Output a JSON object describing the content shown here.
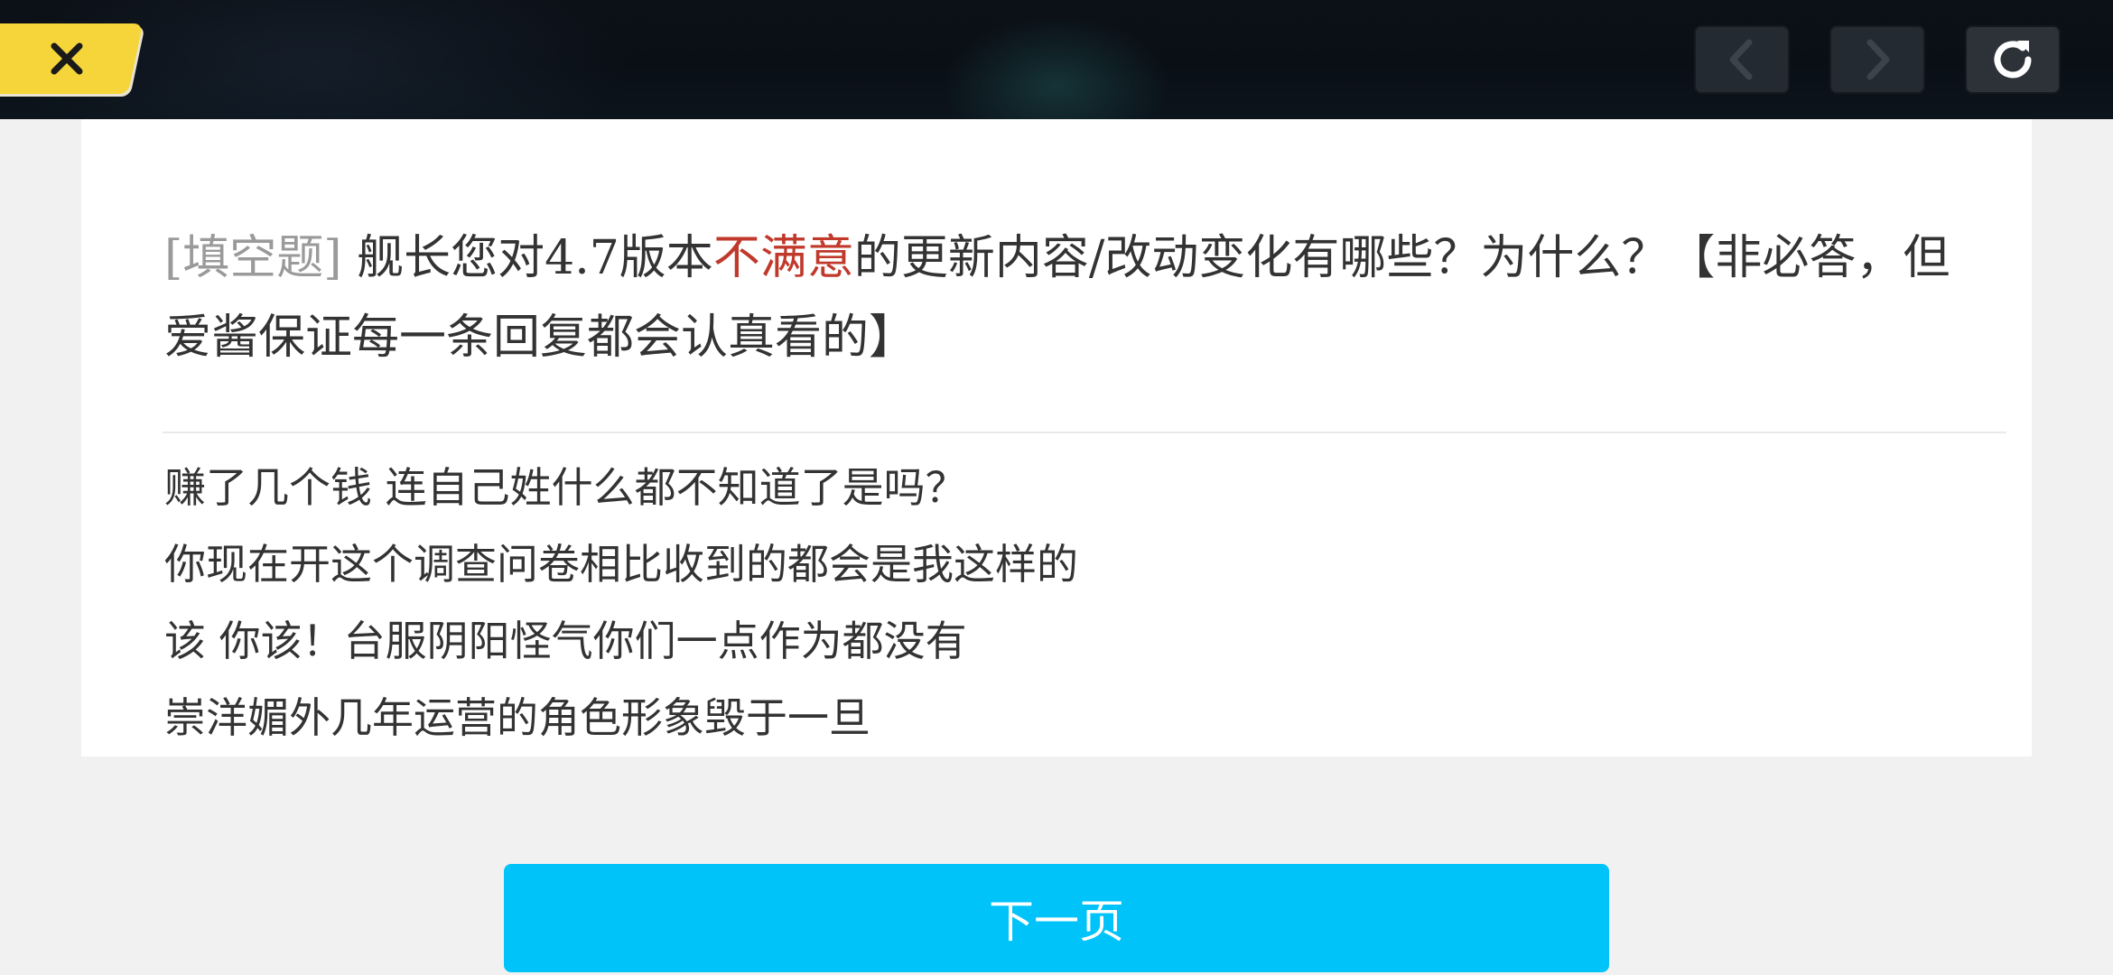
{
  "topbar": {
    "close_icon": "close-icon",
    "back_icon": "chevron-left-icon",
    "forward_icon": "chevron-right-icon",
    "refresh_icon": "refresh-icon",
    "close_color": "#f6d53a"
  },
  "question": {
    "type_label": "[填空题]",
    "text_before": " 舰长您对4.7版本",
    "highlight": "不满意",
    "text_after": "的更新内容/改动变化有哪些？为什么？【非必答，但爱酱保证每一条回复都会认真看的】",
    "highlight_color": "#c0392b"
  },
  "answer": {
    "lines": [
      "赚了几个钱 连自己姓什么都不知道了是吗？",
      "你现在开这个调查问卷相比收到的都会是我这样的",
      "该 你该！台服阴阳怪气你们一点作为都没有",
      "崇洋媚外几年运营的角色形象毁于一旦"
    ]
  },
  "footer": {
    "next_label": "下一页",
    "button_color": "#00c3fa"
  }
}
